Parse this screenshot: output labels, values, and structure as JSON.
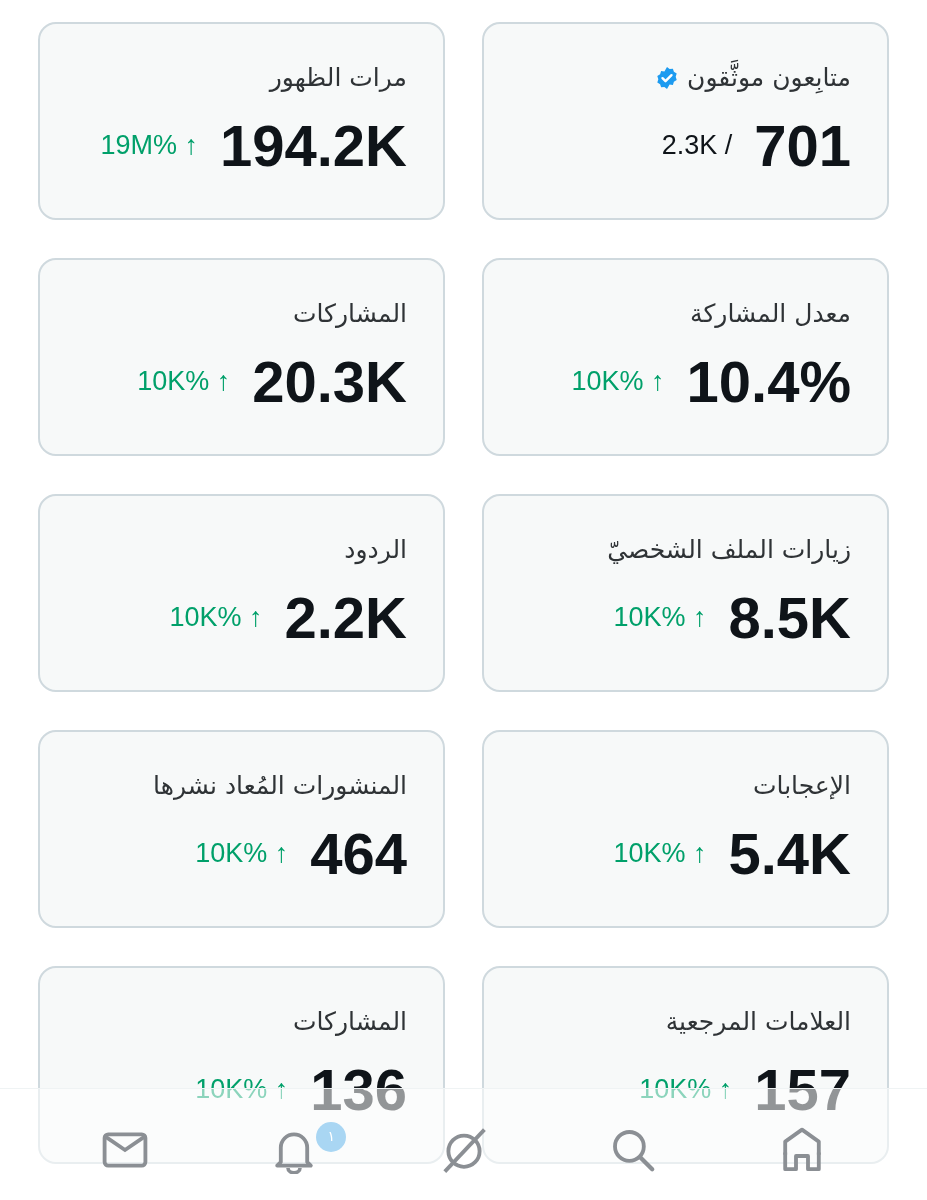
{
  "cards": [
    {
      "label": "متابِعون موثَّقون",
      "verified": true,
      "value": "701",
      "kind": "ratio",
      "secondary": "2.3K /"
    },
    {
      "label": "مرات الظهور",
      "verified": false,
      "value": "194.2K",
      "kind": "delta",
      "change": "19M%",
      "arrow": "↑"
    },
    {
      "label": "معدل المشاركة",
      "verified": false,
      "value": "10.4%",
      "kind": "delta",
      "change": "10K%",
      "arrow": "↑"
    },
    {
      "label": "المشاركات",
      "verified": false,
      "value": "20.3K",
      "kind": "delta",
      "change": "10K%",
      "arrow": "↑"
    },
    {
      "label": "زيارات الملف الشخصيّ",
      "verified": false,
      "value": "8.5K",
      "kind": "delta",
      "change": "10K%",
      "arrow": "↑"
    },
    {
      "label": "الردود",
      "verified": false,
      "value": "2.2K",
      "kind": "delta",
      "change": "10K%",
      "arrow": "↑"
    },
    {
      "label": "الإعجابات",
      "verified": false,
      "value": "5.4K",
      "kind": "delta",
      "change": "10K%",
      "arrow": "↑"
    },
    {
      "label": "المنشورات المُعاد نشرها",
      "verified": false,
      "value": "464",
      "kind": "delta",
      "change": "10K%",
      "arrow": "↑"
    },
    {
      "label": "العلامات المرجعية",
      "verified": false,
      "value": "157",
      "kind": "delta",
      "change": "10K%",
      "arrow": "↑"
    },
    {
      "label": "المشاركات",
      "verified": false,
      "value": "136",
      "kind": "delta",
      "change": "10K%",
      "arrow": "↑"
    }
  ],
  "nav": [
    {
      "kind": "home"
    },
    {
      "kind": "search"
    },
    {
      "kind": "slash"
    },
    {
      "kind": "bell",
      "badge": "١"
    },
    {
      "kind": "mail"
    }
  ]
}
